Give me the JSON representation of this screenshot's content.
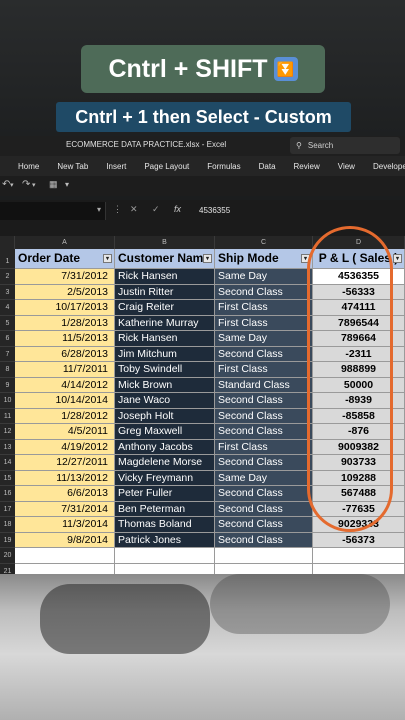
{
  "captions": {
    "shortcut": "Cntrl + SHIFT",
    "shortcut_emoji": "⏬",
    "instruction": "Cntrl + 1  then Select - Custom"
  },
  "window": {
    "file_title": "ECOMMERCE DATA PRACTICE.xlsx  -  Excel",
    "search_placeholder": "Search"
  },
  "menu": [
    "Home",
    "New Tab",
    "Insert",
    "Page Layout",
    "Formulas",
    "Data",
    "Review",
    "View",
    "Developer"
  ],
  "formula_bar": {
    "value": "4536355",
    "cancel": "✕",
    "enter": "✓",
    "fx": "fx"
  },
  "columns": [
    "A",
    "B",
    "C",
    "D"
  ],
  "headers": [
    "Order Date",
    "Customer Name",
    "Ship Mode",
    "P & L ( Sales )"
  ],
  "rows": [
    {
      "n": "2",
      "date": "7/31/2012",
      "name": "Rick Hansen",
      "ship": "Same Day",
      "pl": "4536355"
    },
    {
      "n": "3",
      "date": "2/5/2013",
      "name": "Justin Ritter",
      "ship": "Second Class",
      "pl": "-56333"
    },
    {
      "n": "4",
      "date": "10/17/2013",
      "name": "Craig Reiter",
      "ship": "First Class",
      "pl": "474111"
    },
    {
      "n": "5",
      "date": "1/28/2013",
      "name": "Katherine Murray",
      "ship": "First Class",
      "pl": "7896544"
    },
    {
      "n": "6",
      "date": "11/5/2013",
      "name": "Rick Hansen",
      "ship": "Same Day",
      "pl": "789664"
    },
    {
      "n": "7",
      "date": "6/28/2013",
      "name": "Jim Mitchum",
      "ship": "Second Class",
      "pl": "-2311"
    },
    {
      "n": "8",
      "date": "11/7/2011",
      "name": "Toby Swindell",
      "ship": "First Class",
      "pl": "988899"
    },
    {
      "n": "9",
      "date": "4/14/2012",
      "name": "Mick Brown",
      "ship": "Standard Class",
      "pl": "50000"
    },
    {
      "n": "10",
      "date": "10/14/2014",
      "name": "Jane Waco",
      "ship": "Second Class",
      "pl": "-8939"
    },
    {
      "n": "11",
      "date": "1/28/2012",
      "name": "Joseph Holt",
      "ship": "Second Class",
      "pl": "-85858"
    },
    {
      "n": "12",
      "date": "4/5/2011",
      "name": "Greg Maxwell",
      "ship": "Second Class",
      "pl": "-876"
    },
    {
      "n": "13",
      "date": "4/19/2012",
      "name": "Anthony Jacobs",
      "ship": "First Class",
      "pl": "9009382"
    },
    {
      "n": "14",
      "date": "12/27/2011",
      "name": "Magdelene Morse",
      "ship": "Second Class",
      "pl": "903733"
    },
    {
      "n": "15",
      "date": "11/13/2012",
      "name": "Vicky Freymann",
      "ship": "Same Day",
      "pl": "109288"
    },
    {
      "n": "16",
      "date": "6/6/2013",
      "name": "Peter Fuller",
      "ship": "Second Class",
      "pl": "567488"
    },
    {
      "n": "17",
      "date": "7/31/2014",
      "name": "Ben Peterman",
      "ship": "Second Class",
      "pl": "-77635"
    },
    {
      "n": "18",
      "date": "11/3/2014",
      "name": "Thomas Boland",
      "ship": "Second Class",
      "pl": "9029333"
    },
    {
      "n": "19",
      "date": "9/8/2014",
      "name": "Patrick Jones",
      "ship": "Second Class",
      "pl": "-56373"
    }
  ],
  "extra_rows": [
    "20",
    "21"
  ],
  "header_row": "1",
  "colors": {
    "highlight_oval": "#e46a2e",
    "header_fill": "#b4c7e7",
    "date_fill": "#ffe699"
  }
}
